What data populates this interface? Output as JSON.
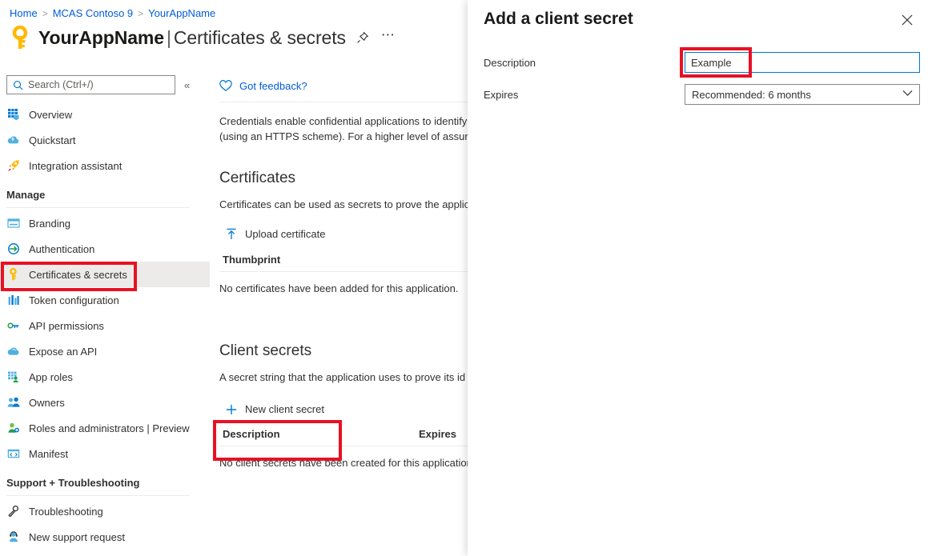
{
  "breadcrumb": {
    "items": [
      "Home",
      "MCAS Contoso 9",
      "YourAppName"
    ],
    "separator": ">"
  },
  "header": {
    "app_name": "YourAppName",
    "separator": "|",
    "page_name": "Certificates & secrets",
    "key_icon": "key-icon",
    "pin_icon": "pin-icon",
    "more_icon": "ellipsis-icon"
  },
  "sidebar": {
    "search": {
      "placeholder": "Search (Ctrl+/)",
      "value": "",
      "icon": "search-icon"
    },
    "collapse_icon": "«",
    "top_items": [
      {
        "label": "Overview",
        "icon": "grid-icon"
      },
      {
        "label": "Quickstart",
        "icon": "cloud-lightning-icon"
      },
      {
        "label": "Integration assistant",
        "icon": "rocket-icon"
      }
    ],
    "groups": [
      {
        "title": "Manage",
        "items": [
          {
            "label": "Branding",
            "icon": "browser-window-icon"
          },
          {
            "label": "Authentication",
            "icon": "authentication-arrow-icon"
          },
          {
            "label": "Certificates & secrets",
            "icon": "key-icon",
            "selected": true
          },
          {
            "label": "Token configuration",
            "icon": "bars-icon"
          },
          {
            "label": "API permissions",
            "icon": "api-key-icon"
          },
          {
            "label": "Expose an API",
            "icon": "cloud-icon"
          },
          {
            "label": "App roles",
            "icon": "app-roles-icon"
          },
          {
            "label": "Owners",
            "icon": "owners-icon"
          },
          {
            "label": "Roles and administrators | Preview",
            "icon": "role-person-icon"
          },
          {
            "label": "Manifest",
            "icon": "manifest-icon"
          }
        ]
      },
      {
        "title": "Support + Troubleshooting",
        "items": [
          {
            "label": "Troubleshooting",
            "icon": "wrench-icon"
          },
          {
            "label": "New support request",
            "icon": "support-person-icon"
          }
        ]
      }
    ]
  },
  "main": {
    "feedback": {
      "label": "Got feedback?",
      "icon": "heart-icon"
    },
    "intro_line1": "Credentials enable confidential applications to identify",
    "intro_line2": "(using an HTTPS scheme). For a higher level of assuran",
    "certificates": {
      "heading": "Certificates",
      "description": "Certificates can be used as secrets to prove the applica",
      "upload_button": {
        "label": "Upload certificate",
        "icon": "upload-icon"
      },
      "column_header": "Thumbprint",
      "empty_text": "No certificates have been added for this application."
    },
    "client_secrets": {
      "heading": "Client secrets",
      "description": "A secret string that the application uses to prove its id",
      "new_button": {
        "label": "New client secret",
        "icon": "plus-icon"
      },
      "columns": [
        "Description",
        "Expires"
      ],
      "empty_text": "No client secrets have been created for this application"
    }
  },
  "panel": {
    "title": "Add a client secret",
    "close_icon": "close-icon",
    "fields": {
      "description": {
        "label": "Description",
        "value": "Example",
        "placeholder": ""
      },
      "expires": {
        "label": "Expires",
        "value": "Recommended: 6 months",
        "chevron_icon": "chevron-down-icon"
      }
    }
  },
  "callouts": {
    "highlight_color": "#e81123",
    "targets": [
      "sidebar-item-certificates-secrets",
      "new-client-secret-button",
      "description-input"
    ]
  }
}
